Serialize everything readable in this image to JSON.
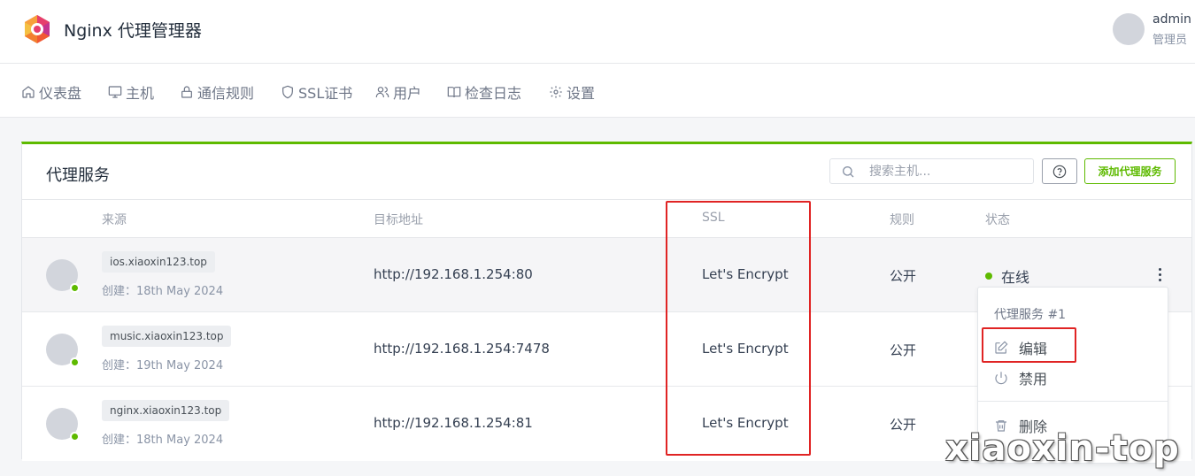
{
  "header": {
    "app_title": "Nginx 代理管理器",
    "user": {
      "name": "admin",
      "role": "管理员"
    }
  },
  "nav": {
    "items": [
      {
        "label": "仪表盘",
        "icon": "home-icon"
      },
      {
        "label": "主机",
        "icon": "monitor-icon"
      },
      {
        "label": "通信规则",
        "icon": "lock-icon"
      },
      {
        "label": "SSL证书",
        "icon": "shield-icon"
      },
      {
        "label": "用户",
        "icon": "users-icon"
      },
      {
        "label": "检查日志",
        "icon": "book-icon"
      },
      {
        "label": "设置",
        "icon": "gear-icon"
      }
    ]
  },
  "card": {
    "title": "代理服务",
    "search_placeholder": "搜索主机...",
    "add_button": "添加代理服务",
    "accent_color": "#5eba00"
  },
  "table": {
    "columns": [
      "来源",
      "目标地址",
      "SSL",
      "规则",
      "状态"
    ],
    "rows": [
      {
        "domain": "ios.xiaoxin123.top",
        "created": "创建：18th May 2024",
        "target": "http://192.168.1.254:80",
        "ssl": "Let's Encrypt",
        "rule": "公开",
        "status": "在线"
      },
      {
        "domain": "music.xiaoxin123.top",
        "created": "创建：19th May 2024",
        "target": "http://192.168.1.254:7478",
        "ssl": "Let's Encrypt",
        "rule": "公开"
      },
      {
        "domain": "nginx.xiaoxin123.top",
        "created": "创建：18th May 2024",
        "target": "http://192.168.1.254:81",
        "ssl": "Let's Encrypt",
        "rule": "公开"
      }
    ]
  },
  "dropdown": {
    "header": "代理服务 #1",
    "items": [
      {
        "label": "编辑",
        "icon": "edit-icon"
      },
      {
        "label": "禁用",
        "icon": "power-icon"
      },
      {
        "label": "删除",
        "icon": "trash-icon"
      }
    ]
  },
  "watermark": "xiaoxin-top",
  "annotation_color": "#e02424"
}
